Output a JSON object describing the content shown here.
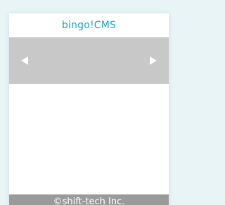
{
  "header": {
    "logo_text": "bingo!CMS"
  },
  "slider": {
    "prev_icon": "triangle-left-icon",
    "next_icon": "triangle-right-icon"
  },
  "footer": {
    "copyright": "©shift-tech Inc."
  },
  "colors": {
    "brand": "#1aa3c9",
    "slider_bg": "#c8c8c8",
    "footer_bg": "#9a9a9a"
  }
}
